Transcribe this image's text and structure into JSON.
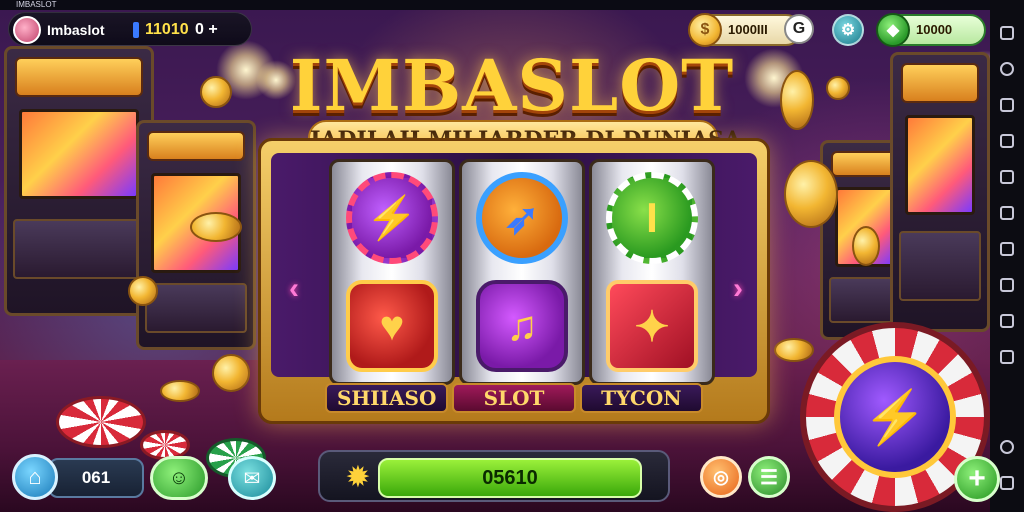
{
  "topbar": {
    "app_title": "IMBASLOT"
  },
  "profile": {
    "username": "Imbaslot",
    "balance": "11010",
    "extra": "0 +"
  },
  "header": {
    "coins": "1000III",
    "gems": "10000",
    "coin_icon": "coin-icon",
    "gem_icon": "gem-icon",
    "g_icon": "g-badge-icon",
    "settings_icon": "gear-icon"
  },
  "game": {
    "title": "IMBASLOT",
    "subtitle": "JADILAH MILIARDER DI DUNIASA",
    "reel_labels": [
      "SHIIASO",
      "SLOT",
      "TYCON"
    ],
    "arrow_left": "‹",
    "arrow_right": "›",
    "reels": [
      {
        "top_symbol": "⚡",
        "bottom_symbol": "♥"
      },
      {
        "top_symbol": "➶",
        "bottom_symbol": "♫"
      },
      {
        "top_symbol": "I",
        "bottom_symbol": "✦"
      }
    ]
  },
  "bottom": {
    "home_icon": "⌂",
    "level": "061",
    "shop_icon": "☺",
    "mail_icon": "✉",
    "spin_value": "05610",
    "star_icon": "✹",
    "orange_icon": "◎",
    "menu_icon": "☰",
    "add_icon": "+",
    "chip_symbol": "⚡"
  },
  "colors": {
    "accent_gold": "#ffd23a",
    "spin_green": "#3aa80a",
    "chip_red": "#d82a3a",
    "reel_purple": "#4a1a6a"
  }
}
